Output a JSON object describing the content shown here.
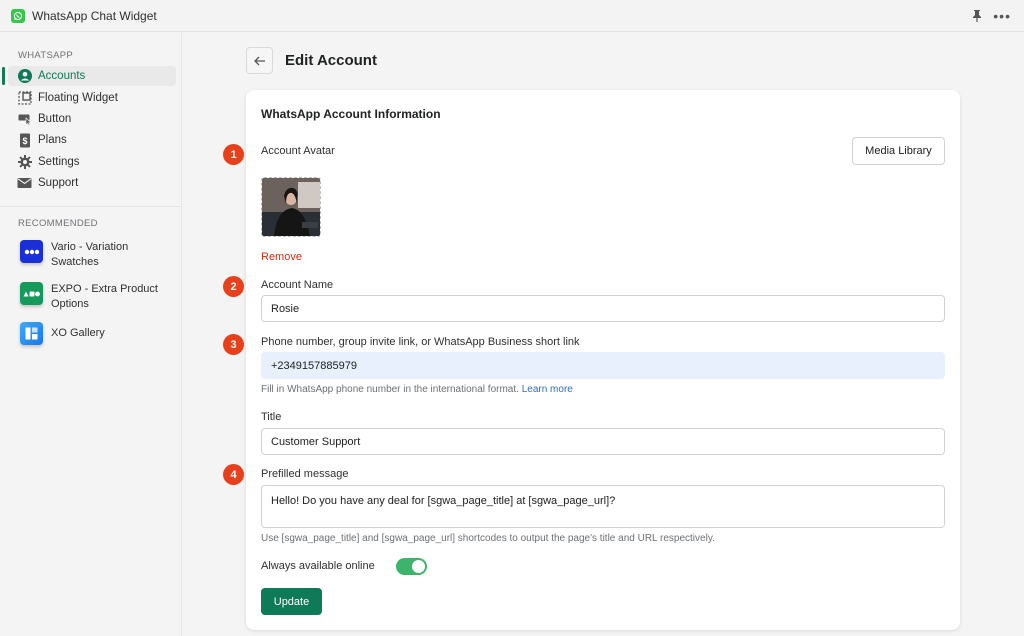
{
  "app": {
    "title": "WhatsApp Chat Widget",
    "more_label": "•••"
  },
  "sidebar": {
    "section_whatsapp": "WHATSAPP",
    "items": [
      {
        "label": "Accounts",
        "icon": "user-circle-icon",
        "active": true
      },
      {
        "label": "Floating Widget",
        "icon": "floating-widget-icon",
        "active": false
      },
      {
        "label": "Button",
        "icon": "button-cursor-icon",
        "active": false
      },
      {
        "label": "Plans",
        "icon": "dollar-receipt-icon",
        "active": false
      },
      {
        "label": "Settings",
        "icon": "gear-icon",
        "active": false
      },
      {
        "label": "Support",
        "icon": "envelope-icon",
        "active": false
      }
    ],
    "section_recommended": "RECOMMENDED",
    "recommended": [
      {
        "label": "Vario - Variation Swatches",
        "icon": "vario-app-icon",
        "color": "#1a2fd6"
      },
      {
        "label": "EXPO - Extra Product Options",
        "icon": "expo-app-icon",
        "color": "#169a5b"
      },
      {
        "label": "XO Gallery",
        "icon": "xo-gallery-app-icon",
        "color": "#2b8ff0"
      }
    ]
  },
  "header": {
    "title": "Edit Account"
  },
  "form": {
    "card_title": "WhatsApp Account Information",
    "avatar_label": "Account Avatar",
    "media_library_label": "Media Library",
    "remove_label": "Remove",
    "name_label": "Account Name",
    "name_value": "Rosie",
    "phone_label": "Phone number, group invite link, or WhatsApp Business short link",
    "phone_value": "+2349157885979",
    "phone_help": "Fill in WhatsApp phone number in the international format.",
    "phone_help_link": "Learn more",
    "title_label": "Title",
    "title_value": "Customer Support",
    "message_label": "Prefilled message",
    "message_value": "Hello! Do you have any deal for [sgwa_page_title] at [sgwa_page_url]?",
    "message_help": "Use [sgwa_page_title] and [sgwa_page_url] shortcodes to output the page's title and URL respectively.",
    "online_label": "Always available online",
    "online_enabled": true,
    "update_label": "Update"
  },
  "badges": [
    "1",
    "2",
    "3",
    "4"
  ],
  "colors": {
    "accent": "#0f7a57",
    "toggle_on": "#3db36b",
    "danger": "#d72c0d",
    "link": "#2c6ecb",
    "badge": "#e8401a"
  }
}
